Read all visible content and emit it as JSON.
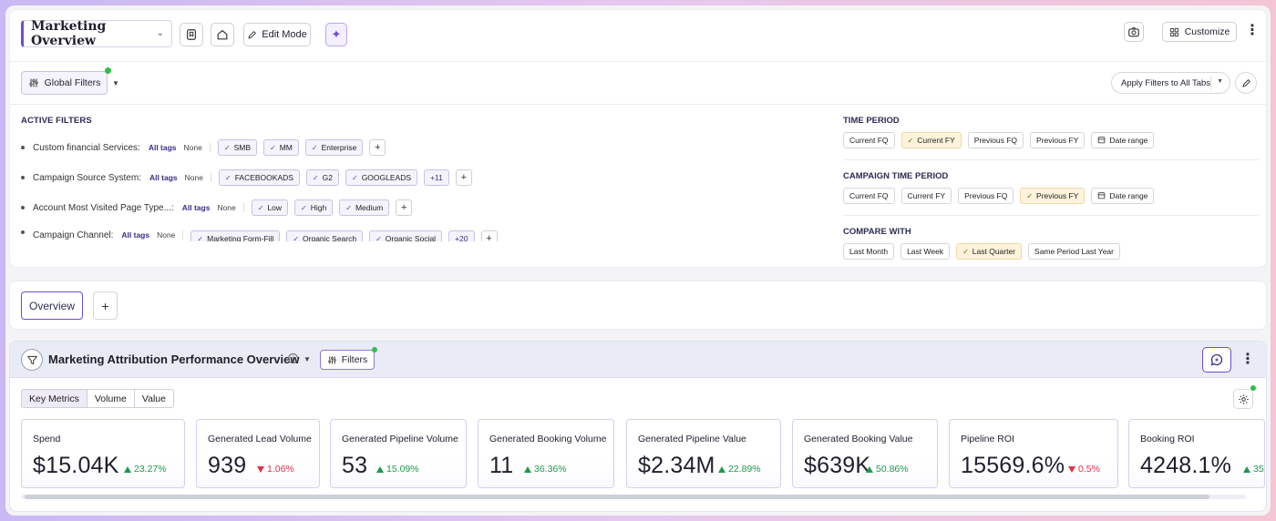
{
  "header": {
    "dashboard_title": "Marketing Overview",
    "edit_mode_label": "Edit Mode",
    "customize_label": "Customize"
  },
  "filters_bar": {
    "global_filters_label": "Global Filters",
    "apply_label": "Apply Filters to All Tabs"
  },
  "active_filters": {
    "title": "ACTIVE FILTERS",
    "all_tags_label": "All tags",
    "none_label": "None",
    "rows": [
      {
        "label": "Custom financial Services:",
        "tags": [
          "SMB",
          "MM",
          "Enterprise"
        ],
        "more": ""
      },
      {
        "label": "Campaign Source System:",
        "tags": [
          "FACEBOOKADS",
          "G2",
          "GOOGLEADS"
        ],
        "more": "+11"
      },
      {
        "label": "Account Most Visited Page Type...:",
        "tags": [
          "Low",
          "High",
          "Medium"
        ],
        "more": ""
      },
      {
        "label": "Campaign Channel:",
        "tags": [
          "Marketing Form-Fill",
          "Organic Search",
          "Organic Social"
        ],
        "more": "+20"
      }
    ]
  },
  "time_period": {
    "title": "TIME PERIOD",
    "options": [
      "Current FQ",
      "Current FY",
      "Previous FQ",
      "Previous FY",
      "Date range"
    ],
    "selected": "Current FY"
  },
  "campaign_time_period": {
    "title": "CAMPAIGN TIME PERIOD",
    "options": [
      "Current FQ",
      "Current FY",
      "Previous FQ",
      "Previous FY",
      "Date range"
    ],
    "selected": "Previous FY"
  },
  "compare_with": {
    "title": "COMPARE WITH",
    "options": [
      "Last Month",
      "Last Week",
      "Last Quarter",
      "Same Period Last Year"
    ],
    "selected": "Last Quarter"
  },
  "tabs": {
    "items": [
      "Overview"
    ],
    "add_label": "+"
  },
  "widget": {
    "title": "Marketing Attribution Performance Overview",
    "filters_label": "Filters",
    "segments": [
      "Key Metrics",
      "Volume",
      "Value"
    ],
    "active_segment": "Key Metrics",
    "metrics": [
      {
        "title": "Spend",
        "value": "$15.04K",
        "delta": "23.27%",
        "trend": "up"
      },
      {
        "title": "Generated Lead Volume",
        "value": "939",
        "delta": "1.06%",
        "trend": "down"
      },
      {
        "title": "Generated Pipeline Volume",
        "value": "53",
        "delta": "15.09%",
        "trend": "up"
      },
      {
        "title": "Generated Booking Volume",
        "value": "11",
        "delta": "36.36%",
        "trend": "up"
      },
      {
        "title": "Generated Pipeline Value",
        "value": "$2.34M",
        "delta": "22.89%",
        "trend": "up"
      },
      {
        "title": "Generated Booking Value",
        "value": "$639K",
        "delta": "50.86%",
        "trend": "up"
      },
      {
        "title": "Pipeline ROI",
        "value": "15569.6%",
        "delta": "0.5%",
        "trend": "down"
      },
      {
        "title": "Booking ROI",
        "value": "4248.1%",
        "delta": "35",
        "trend": "up"
      }
    ]
  },
  "colors": {
    "accent": "#6d4ad8",
    "positive": "#1c9a4e",
    "negative": "#e0314b",
    "selected_pill": "#fff3dc"
  }
}
